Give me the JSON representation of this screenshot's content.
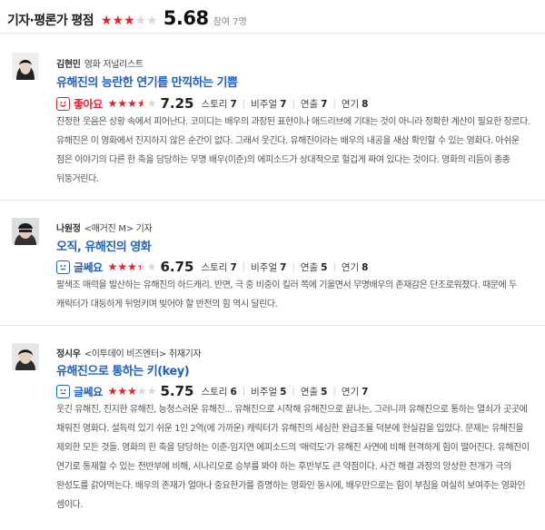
{
  "header": {
    "title": "기자·평론가 평점",
    "rating": 2.84,
    "score": "5.68",
    "count": "참여 7명"
  },
  "colors": {
    "accent_red": "#e8202a",
    "accent_blue": "#1f5fbf"
  },
  "reviews": [
    {
      "name": "김현민",
      "role": "영화 저널리스트",
      "headline": "유해진의 능란한 연기를 만끽하는 기쁨",
      "mood": "좋아요",
      "mood_icon": "smile-icon",
      "rating": 3.6,
      "score": "7.25",
      "criteria": [
        {
          "label": "스토리",
          "value": "7"
        },
        {
          "label": "비주얼",
          "value": "7"
        },
        {
          "label": "연출",
          "value": "7"
        },
        {
          "label": "연기",
          "value": "8"
        }
      ],
      "text": "진정한 웃음은 상황 속에서 피어난다. 코미디는 배우의 과장된 표현이나 애드리브에 기대는 것이 아니라 정확한 계산이 필요한 장르다. 유해진은 이 영화에서 진지하지 않은 순간이 없다. 그래서 웃긴다. 유해진이라는 배우의 내공을 새삼 확인할 수 있는 영화다. 아쉬운 점은 이야기의 다른 한 축을 담당하는 무명 배우(이준)의 에피소드가 상대적으로 헐겁게 짜여 있다는 것이다. 영화의 리듬이 종종 뒤뚱거린다."
    },
    {
      "name": "나원정",
      "role": "<매거진 M> 기자",
      "headline": "오직, 유해진의 영화",
      "mood": "글쎄요",
      "mood_icon": "neutral-face-icon",
      "rating": 3.4,
      "score": "6.75",
      "criteria": [
        {
          "label": "스토리",
          "value": "7"
        },
        {
          "label": "비주얼",
          "value": "7"
        },
        {
          "label": "연출",
          "value": "5"
        },
        {
          "label": "연기",
          "value": "8"
        }
      ],
      "text": "팔색조 매력을 발산하는 유해진의 하드캐리. 반면, 극 중 비중이 킬러 쪽에 기울면서 무명배우의 존재감은 단조로워졌다. 때문에 두 캐릭터가 대등하게 뒤엉키며 빚어야 할 반전의 힘 역시 달린다."
    },
    {
      "name": "정시우",
      "role": "<이투데이 비즈엔터> 취재기자",
      "headline": "유해진으로 통하는 키(key)",
      "mood": "글쎄요",
      "mood_icon": "neutral-face-icon",
      "rating": 2.9,
      "score": "5.75",
      "criteria": [
        {
          "label": "스토리",
          "value": "6"
        },
        {
          "label": "비주얼",
          "value": "5"
        },
        {
          "label": "연출",
          "value": "5"
        },
        {
          "label": "연기",
          "value": "7"
        }
      ],
      "text": "웃긴 유해진, 진지한 유해진, 능청스러운 유해진... 유해진으로 시작해 유해진으로 끝나는, 그러니까 유해진으로 통하는 열쇠가 곳곳에 채워진 영화다. 설득력 있기 쉬운 1인 2역(에 가까운) 캐릭터가 유해진의 세심한 완급조율 덕분에 현실감을 입었다. 문제는 유해진을 제외한 모든 것들. 영화의 한 축을 담당하는 이준-임지연 에피소드의 '매력도'가 유해진 사연에 비해 현격하게 힘이 떨어진다. 유해진이 연기로 통제할 수 있는 전반부에 비해, 시나리오로 승부를 봐야 하는 후반부도 큰 약점이다. 사건 해결 과정의 앙상한 전개가 극의 완성도를 갉아먹는다. 배우의 존재가 얼마나 중요한가를 증명하는 영화인 동시에, 배우만으로는 힘이 부침을 여실히 보여주는 영화인 셈이다."
    }
  ]
}
